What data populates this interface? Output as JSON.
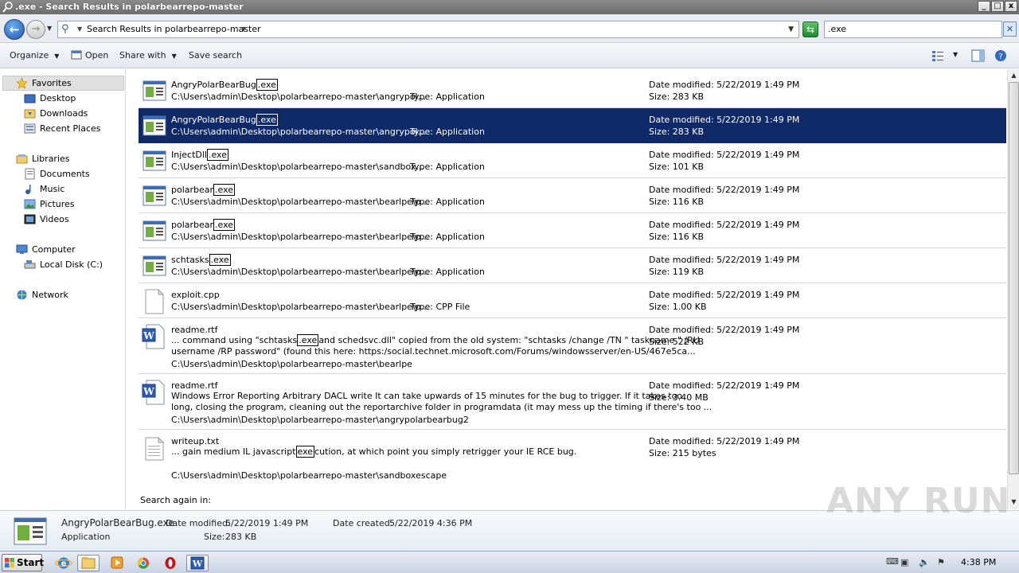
{
  "window": {
    "title": ".exe - Search Results in polarbearrepo-master",
    "buttons": [
      "_",
      "□",
      "x"
    ]
  },
  "address": {
    "path": "Search Results in polarbearrepo-master",
    "search_value": ".exe"
  },
  "toolbar": {
    "organize": "Organize",
    "open": "Open",
    "share_with": "Share with",
    "save_search": "Save search"
  },
  "nav": {
    "favorites": "Favorites",
    "desktop": "Desktop",
    "downloads": "Downloads",
    "recent_places": "Recent Places",
    "libraries": "Libraries",
    "documents": "Documents",
    "music": "Music",
    "pictures": "Pictures",
    "videos": "Videos",
    "computer": "Computer",
    "local_disk": "Local Disk (C:)",
    "network": "Network"
  },
  "results": [
    {
      "name_prefix": "AngryPolarBearBug",
      "name_hl": ".exe",
      "path": "C:\\Users\\admin\\Desktop\\polarbearrepo-master\\angrypol...",
      "type": "Type: Application",
      "date": "Date modified: 5/22/2019 1:49 PM",
      "size": "Size: 283 KB"
    },
    {
      "name_prefix": "AngryPolarBearBug",
      "name_hl": ".exe",
      "path": "C:\\Users\\admin\\Desktop\\polarbearrepo-master\\angrypol...",
      "type": "Type: Application",
      "date": "Date modified: 5/22/2019 1:49 PM",
      "size": "Size: 283 KB"
    },
    {
      "name_prefix": "InjectDll",
      "name_hl": ".exe",
      "path": "C:\\Users\\admin\\Desktop\\polarbearrepo-master\\sandbox...",
      "type": "Type: Application",
      "date": "Date modified: 5/22/2019 1:49 PM",
      "size": "Size: 101 KB"
    },
    {
      "name_prefix": "polarbear",
      "name_hl": ".exe",
      "path": "C:\\Users\\admin\\Desktop\\polarbearrepo-master\\bearlpe\\p...",
      "type": "Type: Application",
      "date": "Date modified: 5/22/2019 1:49 PM",
      "size": "Size: 116 KB"
    },
    {
      "name_prefix": "polarbear",
      "name_hl": ".exe",
      "path": "C:\\Users\\admin\\Desktop\\polarbearrepo-master\\bearlpe\\p...",
      "type": "Type: Application",
      "date": "Date modified: 5/22/2019 1:49 PM",
      "size": "Size: 116 KB"
    },
    {
      "name_prefix": "schtasks",
      "name_hl": ".exe",
      "path": "C:\\Users\\admin\\Desktop\\polarbearrepo-master\\bearlpe\\p...",
      "type": "Type: Application",
      "date": "Date modified: 5/22/2019 1:49 PM",
      "size": "Size: 119 KB"
    },
    {
      "name_prefix": "exploit.cpp",
      "name_hl": "",
      "path": "C:\\Users\\admin\\Desktop\\polarbearrepo-master\\bearlpe\\p...",
      "type": "Type: CPP File",
      "date": "Date modified: 5/22/2019 1:49 PM",
      "size": "Size: 1.00 KB"
    }
  ],
  "snippets": {
    "readme1": {
      "name": "readme.rtf",
      "line1_a": "... command using \"schtasks",
      "line1_hl": ".exe",
      "line1_b": "and schedsvc.dll\" copied from the old system: \"schtasks /change /TN \" taskname \" /RU",
      "line2": "username /RP password\" (found this here: https:/social.technet.microsoft.com/Forums/windowsserver/en-US/467e5ca...",
      "path": "C:\\Users\\admin\\Desktop\\polarbearrepo-master\\bearlpe",
      "date": "Date modified: 5/22/2019 1:49 PM",
      "size": "Size: 522 KB"
    },
    "readme2": {
      "name": "readme.rtf",
      "line1": "Windows Error Reporting Arbitrary DACL write It can take upwards of 15 minutes for the bug to trigger. If it takes too",
      "line2": "long, closing the program, cleaning out the reportarchive folder in programdata (it may mess up the timing if there's too ...",
      "path": "C:\\Users\\admin\\Desktop\\polarbearrepo-master\\angrypolarbearbug2",
      "date": "Date modified: 5/22/2019 1:49 PM",
      "size": "Size: 3.40 MB"
    },
    "writeup": {
      "name": "writeup.txt",
      "line1_a": "... gain medium IL javascript",
      "line1_hl": "exe",
      "line1_b": "cution, at which point you simply retrigger your IE RCE bug.",
      "path": "C:\\Users\\admin\\Desktop\\polarbearrepo-master\\sandboxescape",
      "date": "Date modified: 5/22/2019 1:49 PM",
      "size": "Size: 215 bytes"
    }
  },
  "search_again": "Search again in:",
  "details": {
    "name": "AngryPolarBearBug.exe",
    "type": "Application",
    "modified_label": "Date modified:",
    "modified": "5/22/2019 1:49 PM",
    "created_label": "Date created:",
    "created": "5/22/2019 4:36 PM",
    "size_label": "Size:",
    "size": "283 KB"
  },
  "watermark": "ANY RUN",
  "taskbar": {
    "start": "Start",
    "clock": "4:38 PM"
  },
  "colors": {
    "selection": "#0f2a67",
    "accent": "#1b56b0"
  }
}
